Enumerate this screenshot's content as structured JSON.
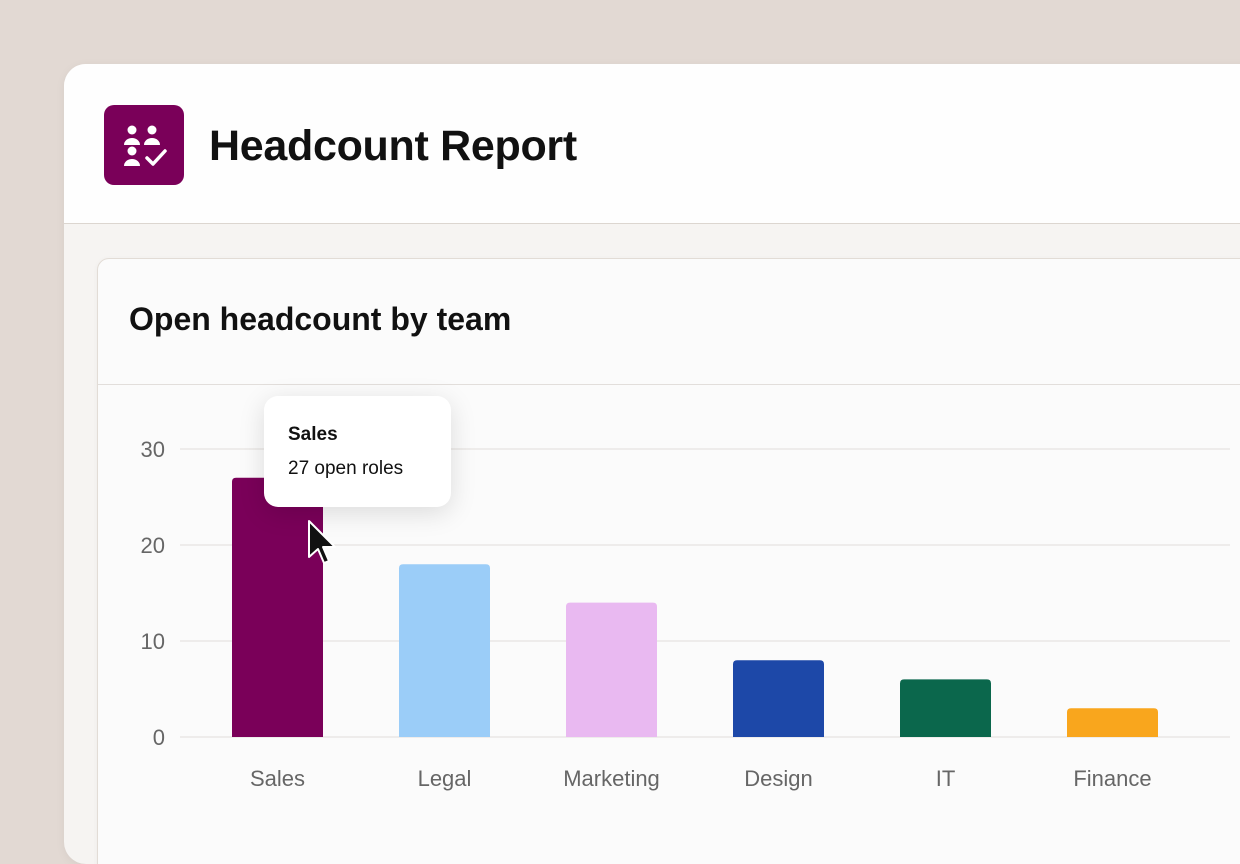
{
  "app": {
    "title": "Headcount Report",
    "icon": "team-check-icon",
    "accent": "#7a0059"
  },
  "card": {
    "title": "Open headcount by team"
  },
  "tooltip": {
    "title": "Sales",
    "value": "27 open roles"
  },
  "chart_data": {
    "type": "bar",
    "title": "Open headcount by team",
    "categories": [
      "Sales",
      "Legal",
      "Marketing",
      "Design",
      "IT",
      "Finance"
    ],
    "values": [
      27,
      18,
      14,
      8,
      6,
      3
    ],
    "colors": [
      "#7a0059",
      "#9bcdf8",
      "#e9b9f1",
      "#1d48a8",
      "#0b674c",
      "#f9a61d"
    ],
    "yticks": [
      0,
      10,
      20,
      30
    ],
    "ylim": [
      0,
      35
    ],
    "grid": true,
    "xlabel": "",
    "ylabel": ""
  }
}
